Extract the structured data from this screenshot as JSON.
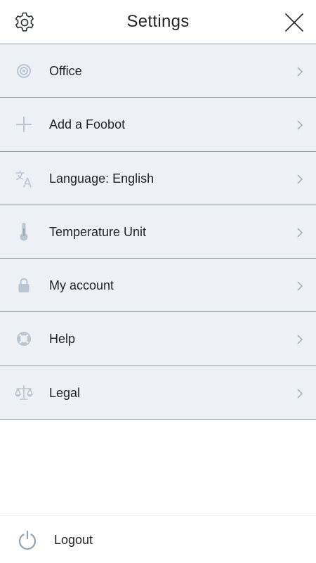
{
  "header": {
    "title": "Settings",
    "left_icon": "gear-icon",
    "right_icon": "close-icon"
  },
  "menu": {
    "items": [
      {
        "label": "Office",
        "icon": "target-icon"
      },
      {
        "label": "Add a Foobot",
        "icon": "plus-icon"
      },
      {
        "label": "Language: English",
        "icon": "translate-icon"
      },
      {
        "label": "Temperature Unit",
        "icon": "thermometer-icon"
      },
      {
        "label": "My account",
        "icon": "lock-icon"
      },
      {
        "label": "Help",
        "icon": "lifebuoy-icon"
      },
      {
        "label": "Legal",
        "icon": "scales-icon"
      }
    ],
    "chevron_icon": "chevron-right-icon"
  },
  "footer": {
    "logout_label": "Logout",
    "logout_icon": "power-icon"
  },
  "colors": {
    "item_background": "#edf1f6",
    "divider": "#8fa0ad",
    "icon": "#b9c6d2",
    "power_icon": "#8fa3b3",
    "text": "#1f2326",
    "chevron": "#9aa7b2"
  }
}
